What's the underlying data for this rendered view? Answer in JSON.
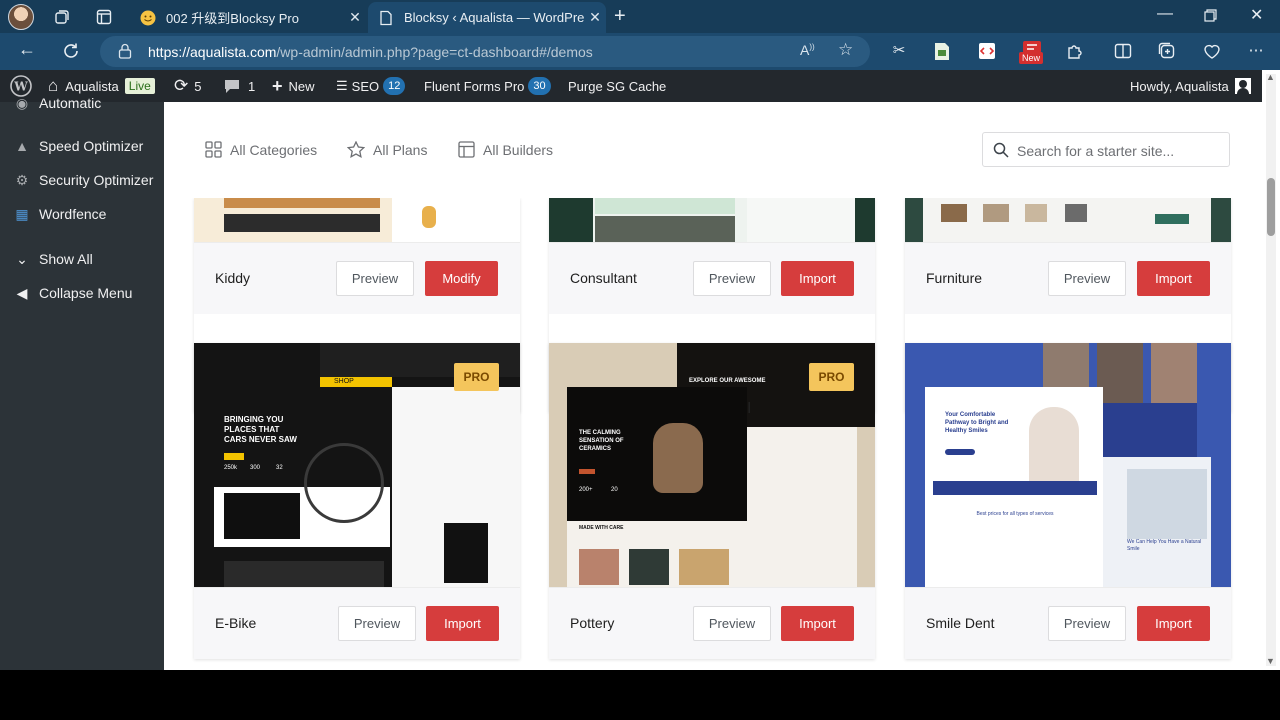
{
  "browser": {
    "tabs": [
      {
        "title": "002 升级到Blocksy Pro",
        "active": false
      },
      {
        "title": "Blocksy ‹ Aqualista — WordPress",
        "active": true
      }
    ],
    "url_host": "https://aqualista.com",
    "url_path": "/wp-admin/admin.php?page=ct-dashboard#/demos",
    "ext_badge": "New"
  },
  "adminbar": {
    "site": "Aqualista",
    "live": "Live",
    "updates": "5",
    "comments": "1",
    "new": "New",
    "seo": "SEO",
    "seo_count": "12",
    "fluent": "Fluent Forms Pro",
    "fluent_count": "30",
    "purge": "Purge SG Cache",
    "howdy": "Howdy, Aqualista"
  },
  "sidebar": {
    "items": [
      {
        "label": "Automatic"
      },
      {
        "label": "Speed Optimizer"
      },
      {
        "label": "Security Optimizer"
      },
      {
        "label": "Wordfence"
      },
      {
        "label": "Show All"
      },
      {
        "label": "Collapse Menu"
      }
    ]
  },
  "filters": {
    "categories": "All Categories",
    "plans": "All Plans",
    "builders": "All Builders",
    "search_placeholder": "Search for a starter site..."
  },
  "cards": [
    {
      "name": "Kiddy",
      "preview": "Preview",
      "action": "Modify",
      "pro": ""
    },
    {
      "name": "Consultant",
      "preview": "Preview",
      "action": "Import",
      "pro": ""
    },
    {
      "name": "Furniture",
      "preview": "Preview",
      "action": "Import",
      "pro": ""
    },
    {
      "name": "E-Bike",
      "preview": "Preview",
      "action": "Import",
      "pro": "PRO"
    },
    {
      "name": "Pottery",
      "preview": "Preview",
      "action": "Import",
      "pro": "PRO"
    },
    {
      "name": "Smile Dent",
      "preview": "Preview",
      "action": "Import",
      "pro": ""
    }
  ],
  "thumbs": {
    "ebike": {
      "shop": "SHOP",
      "headline": "BRINGING YOU PLACES THAT CARS NEVER SAW",
      "stat_1": "250k",
      "stat_2": "300",
      "stat_3": "32"
    },
    "pottery": {
      "headline": "THE CALMING SENSATION OF CERAMICS",
      "explore": "EXPLORE OUR AWESOME",
      "stat_1": "200+",
      "stat_2": "20",
      "made": "MADE WITH CARE"
    },
    "smile": {
      "headline": "Your Comfortable Pathway to Bright and Healthy Smiles",
      "services": "Best prices for all types of services",
      "help": "We Can Help You Have a Natural Smile"
    }
  },
  "colors": {
    "accent_red": "#d63d3d",
    "pro_badge": "#f4c55c",
    "wp_sidebar": "#2c3338",
    "wp_adminbar": "#23282d",
    "browser_frame": "#1d4a6e"
  }
}
